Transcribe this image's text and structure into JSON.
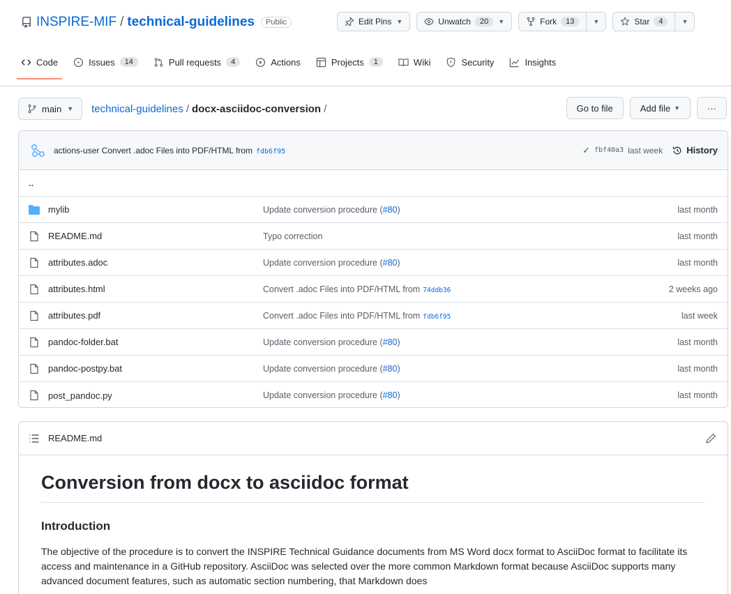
{
  "repo": {
    "owner": "INSPIRE-MIF",
    "separator": "/",
    "name": "technical-guidelines",
    "visibility": "Public"
  },
  "header_buttons": {
    "edit_pins": "Edit Pins",
    "unwatch": "Unwatch",
    "unwatch_count": "20",
    "fork": "Fork",
    "fork_count": "13",
    "star": "Star",
    "star_count": "4"
  },
  "tabs": [
    {
      "label": "Code",
      "count": null,
      "icon": "code-icon"
    },
    {
      "label": "Issues",
      "count": "14",
      "icon": "issue-icon"
    },
    {
      "label": "Pull requests",
      "count": "4",
      "icon": "pull-request-icon"
    },
    {
      "label": "Actions",
      "count": null,
      "icon": "play-icon"
    },
    {
      "label": "Projects",
      "count": "1",
      "icon": "table-icon"
    },
    {
      "label": "Wiki",
      "count": null,
      "icon": "book-icon"
    },
    {
      "label": "Security",
      "count": null,
      "icon": "shield-icon"
    },
    {
      "label": "Insights",
      "count": null,
      "icon": "graph-icon"
    }
  ],
  "nav": {
    "branch": "main",
    "crumb_root": "technical-guidelines",
    "crumb_sep": "/",
    "crumb_current": "docx-asciidoc-conversion",
    "crumb_trailing": "/",
    "go_to_file": "Go to file",
    "add_file": "Add file",
    "more": "···"
  },
  "latest_commit": {
    "author": "actions-user",
    "message": "Convert .adoc Files into PDF/HTML from",
    "message_sha": "fdb6f95",
    "sha": "fbf40a3",
    "time": "last week",
    "history": "History"
  },
  "updir": "..",
  "files": [
    {
      "type": "folder",
      "name": "mylib",
      "msg": "Update conversion procedure (",
      "link": "#80",
      "msg_end": ")",
      "sha": "",
      "age": "last month"
    },
    {
      "type": "file",
      "name": "README.md",
      "msg": "Typo correction",
      "link": "",
      "msg_end": "",
      "sha": "",
      "age": "last month"
    },
    {
      "type": "file",
      "name": "attributes.adoc",
      "msg": "Update conversion procedure (",
      "link": "#80",
      "msg_end": ")",
      "sha": "",
      "age": "last month"
    },
    {
      "type": "file",
      "name": "attributes.html",
      "msg": "Convert .adoc Files into PDF/HTML from",
      "link": "",
      "msg_end": "",
      "sha": "74ddb36",
      "age": "2 weeks ago"
    },
    {
      "type": "file",
      "name": "attributes.pdf",
      "msg": "Convert .adoc Files into PDF/HTML from",
      "link": "",
      "msg_end": "",
      "sha": "fdb6f95",
      "age": "last week"
    },
    {
      "type": "file",
      "name": "pandoc-folder.bat",
      "msg": "Update conversion procedure (",
      "link": "#80",
      "msg_end": ")",
      "sha": "",
      "age": "last month"
    },
    {
      "type": "file",
      "name": "pandoc-postpy.bat",
      "msg": "Update conversion procedure (",
      "link": "#80",
      "msg_end": ")",
      "sha": "",
      "age": "last month"
    },
    {
      "type": "file",
      "name": "post_pandoc.py",
      "msg": "Update conversion procedure (",
      "link": "#80",
      "msg_end": ")",
      "sha": "",
      "age": "last month"
    }
  ],
  "readme": {
    "filename": "README.md",
    "h1": "Conversion from docx to asciidoc format",
    "h2": "Introduction",
    "p1": "The objective of the procedure is to convert the INSPIRE Technical Guidance documents from MS Word docx format to AsciiDoc format to facilitate its access and maintenance in a GitHub repository. AsciiDoc was selected over the more common Markdown format because AsciiDoc supports many advanced document features, such as automatic section numbering, that Markdown does"
  },
  "colors": {
    "link": "#0969da",
    "muted": "#57606a",
    "folder": "#54aeff",
    "tab_underline": "#fd8c73",
    "success": "#1a7f37"
  }
}
